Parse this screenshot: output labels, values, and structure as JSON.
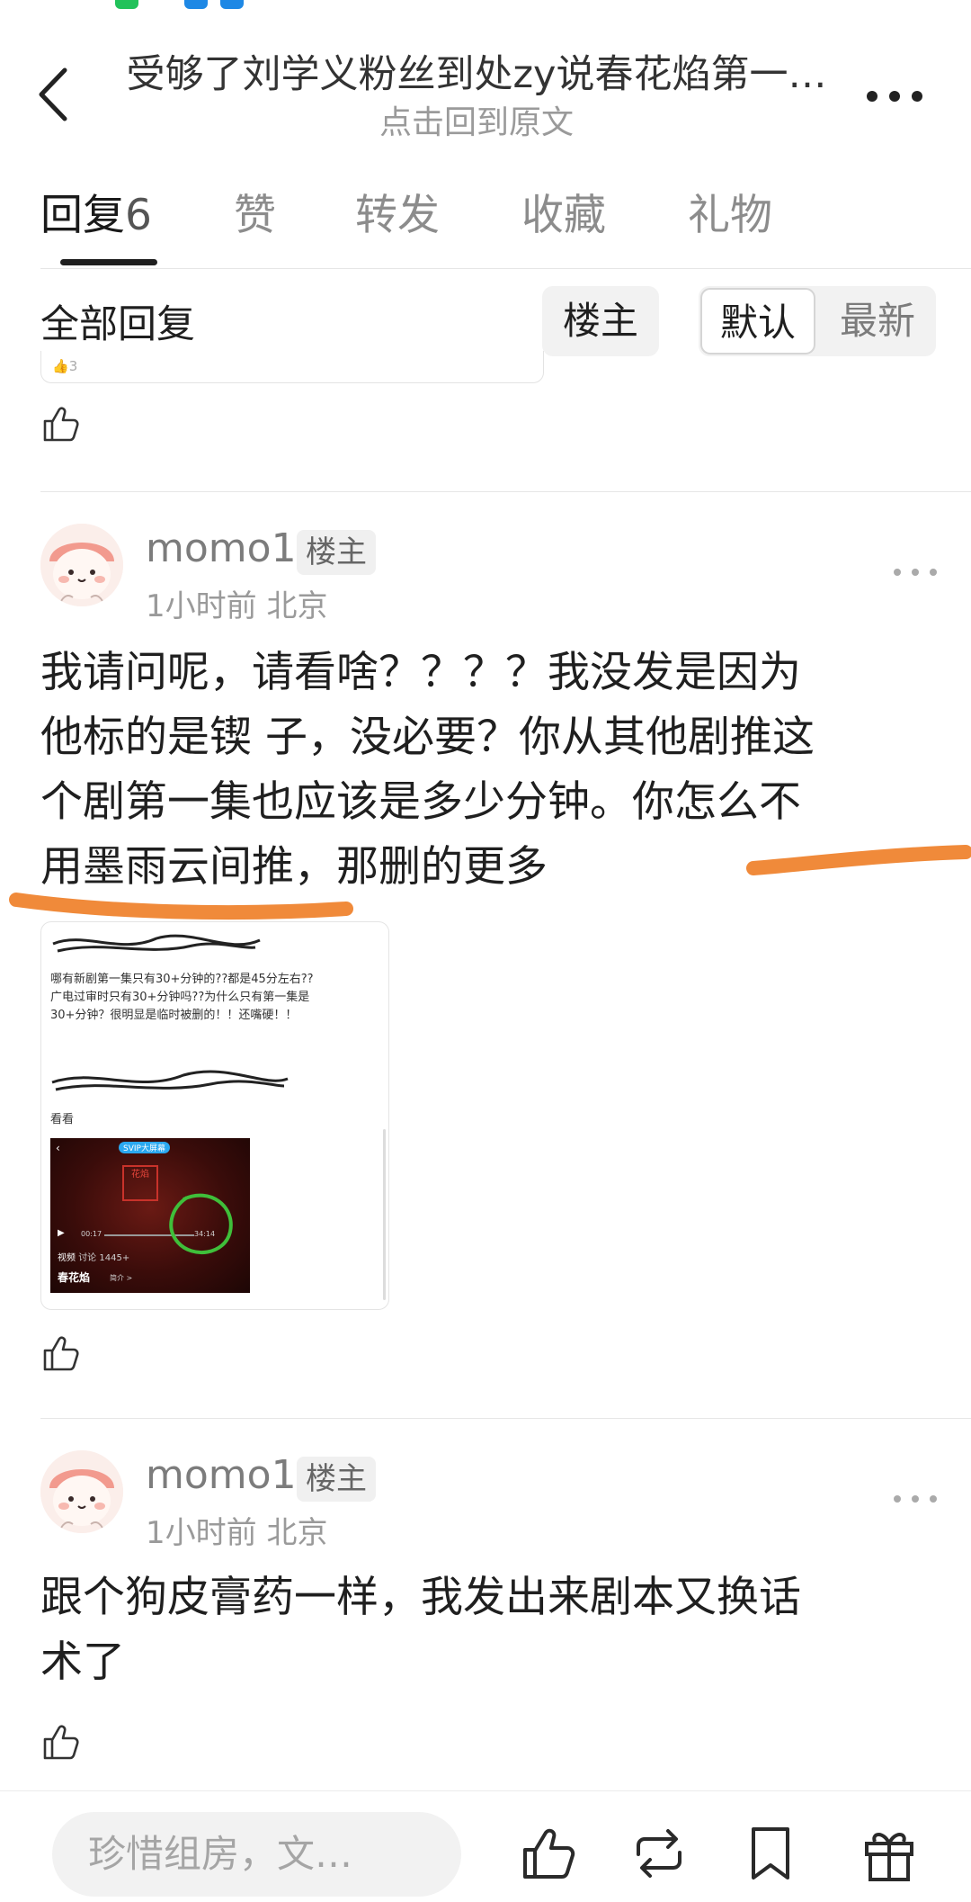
{
  "header": {
    "title": "受够了刘学义粉丝到处zy说春花焰第一…",
    "subtitle": "点击回到原文",
    "back_icon": "chevron-left-icon",
    "more_icon": "more-horizontal-icon"
  },
  "tabs": [
    {
      "label": "回复",
      "count": "6",
      "active": true
    },
    {
      "label": "赞",
      "count": "",
      "active": false
    },
    {
      "label": "转发",
      "count": "",
      "active": false
    },
    {
      "label": "收藏",
      "count": "",
      "active": false
    },
    {
      "label": "礼物",
      "count": "",
      "active": false
    }
  ],
  "filter": {
    "all_replies": "全部回复",
    "op_only": "楼主",
    "sort_default": "默认",
    "sort_latest": "最新"
  },
  "previous_card": {
    "like_count": "3"
  },
  "comments": [
    {
      "username": "momo1",
      "badge": "楼主",
      "time": "1小时前",
      "location": "北京",
      "lines": [
        "我请问呢，请看啥？？？？我没发是因为",
        "他标的是锲 子，没必要？你从其他剧推这",
        "个剧第一集也应该是多少分钟。你怎么不",
        "用墨雨云间推，那删的更多"
      ]
    },
    {
      "username": "momo1",
      "badge": "楼主",
      "time": "1小时前",
      "location": "北京",
      "lines": [
        "跟个狗皮膏药一样，我发出来剧本又换话",
        "术了"
      ]
    }
  ],
  "embedded_image": {
    "post_lines": [
      "哪有新剧第一集只有30+分钟的??都是45分左右??",
      "广电过审时只有30+分钟吗??为什么只有第一集是",
      "30+分钟？很明显是临时被删的！！还嘴硬！！"
    ],
    "reply_text": "看看",
    "video": {
      "top_badge": "SVIP大屏幕",
      "time_current": "00:17",
      "time_total": "34:14",
      "tab_video": "视频",
      "tab_discuss": "讨论",
      "discuss_count": "1445+",
      "show_title": "春花焰",
      "intro_label": "简介 >",
      "seal_text": "花焰"
    }
  },
  "bottom_bar": {
    "input_placeholder": "珍惜组房，文…",
    "icons": [
      "thumbs-up-icon",
      "repost-icon",
      "bookmark-icon",
      "gift-icon"
    ]
  },
  "colors": {
    "highlight_stroke": "#f08a3a",
    "text_primary": "#1f1f1f",
    "text_secondary": "#9a9a9a",
    "pill_bg": "#f2f2f2"
  }
}
